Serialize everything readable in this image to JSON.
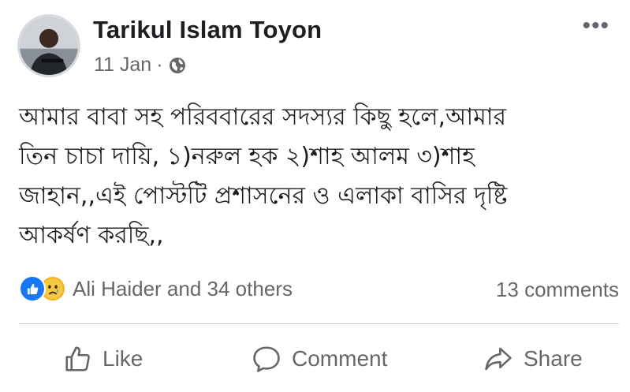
{
  "post": {
    "author": "Tarikul Islam Toyon",
    "date": "11 Jan",
    "separator": "·",
    "privacy_icon": "globe-icon",
    "more_icon": "more-options-icon",
    "more_label": "•••",
    "text": "আমার বাবা সহ পরিববারের সদস্যর কিছু হলে,আমার\nতিন চাচা দায়ি,  ১)নরুল হক ২)শাহ আলম ৩)শাহ\nজাহান,,এই  পোস্টটি প্রশাসনের ও  এলাকা বাসির দৃষ্টি\nআকর্ষণ করছি,,"
  },
  "reactions": {
    "icons": [
      "like-reaction-icon",
      "sad-reaction-icon"
    ],
    "summary": "Ali Haider and 34 others",
    "comments": "13 comments"
  },
  "actions": {
    "like": "Like",
    "comment": "Comment",
    "share": "Share"
  },
  "colors": {
    "text": "#1c1e21",
    "secondary": "#65676b",
    "like_blue": "#1877f2",
    "sad_yellow": "#f7b125",
    "divider": "#ced0d4"
  }
}
